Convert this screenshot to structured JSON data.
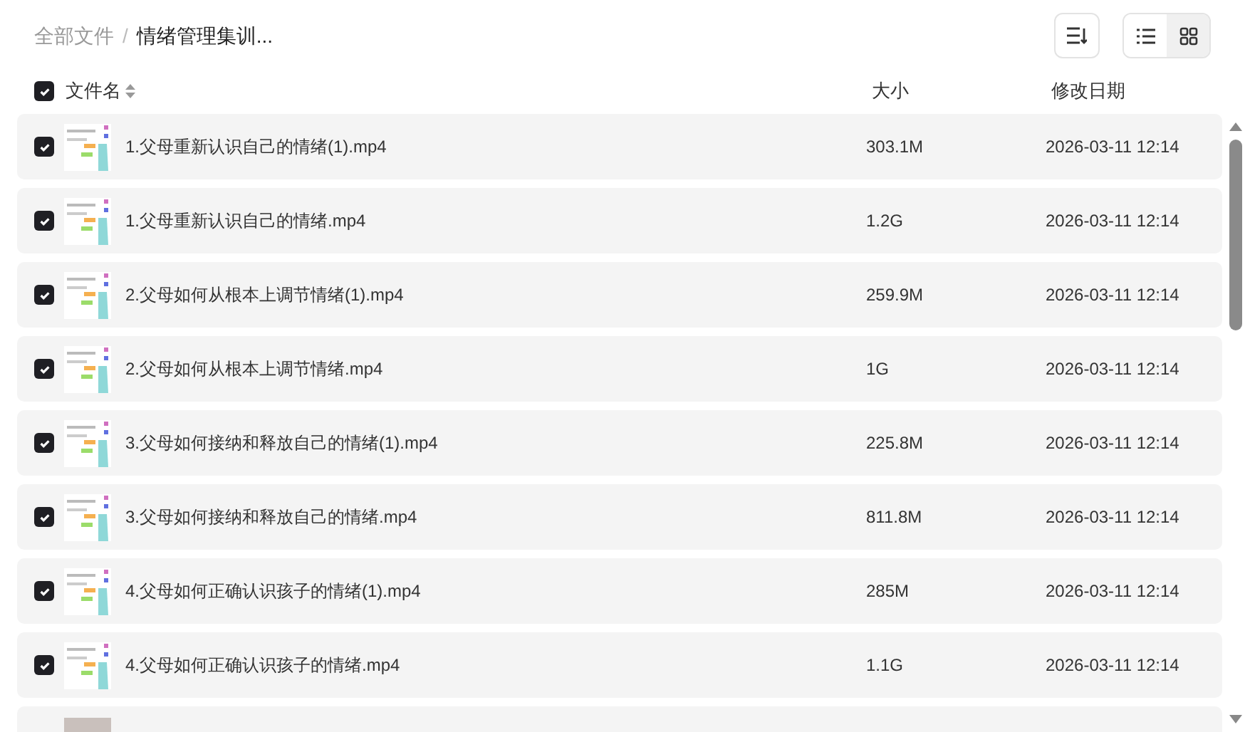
{
  "breadcrumb_separator": "/",
  "breadcrumb": [
    {
      "label": "全部文件",
      "current": false
    },
    {
      "label": "情绪管理集训...",
      "current": true
    }
  ],
  "view_toggle": [
    {
      "kind": "list",
      "selected": false
    },
    {
      "kind": "grid",
      "selected": true
    }
  ],
  "header": {
    "checked": true,
    "name": "文件名",
    "size": "大小",
    "date": "修改日期"
  },
  "rows": [
    {
      "checked": true,
      "name": "1.父母重新认识自己的情绪(1).mp4",
      "size": "303.1M",
      "date": "2026-03-11 12:14"
    },
    {
      "checked": true,
      "name": "1.父母重新认识自己的情绪.mp4",
      "size": "1.2G",
      "date": "2026-03-11 12:14"
    },
    {
      "checked": true,
      "name": "2.父母如何从根本上调节情绪(1).mp4",
      "size": "259.9M",
      "date": "2026-03-11 12:14"
    },
    {
      "checked": true,
      "name": "2.父母如何从根本上调节情绪.mp4",
      "size": "1G",
      "date": "2026-03-11 12:14"
    },
    {
      "checked": true,
      "name": "3.父母如何接纳和释放自己的情绪(1).mp4",
      "size": "225.8M",
      "date": "2026-03-11 12:14"
    },
    {
      "checked": true,
      "name": "3.父母如何接纳和释放自己的情绪.mp4",
      "size": "811.8M",
      "date": "2026-03-11 12:14"
    },
    {
      "checked": true,
      "name": "4.父母如何正确认识孩子的情绪(1).mp4",
      "size": "285M",
      "date": "2026-03-11 12:14"
    },
    {
      "checked": true,
      "name": "4.父母如何正确认识孩子的情绪.mp4",
      "size": "1.1G",
      "date": "2026-03-11 12:14"
    }
  ]
}
